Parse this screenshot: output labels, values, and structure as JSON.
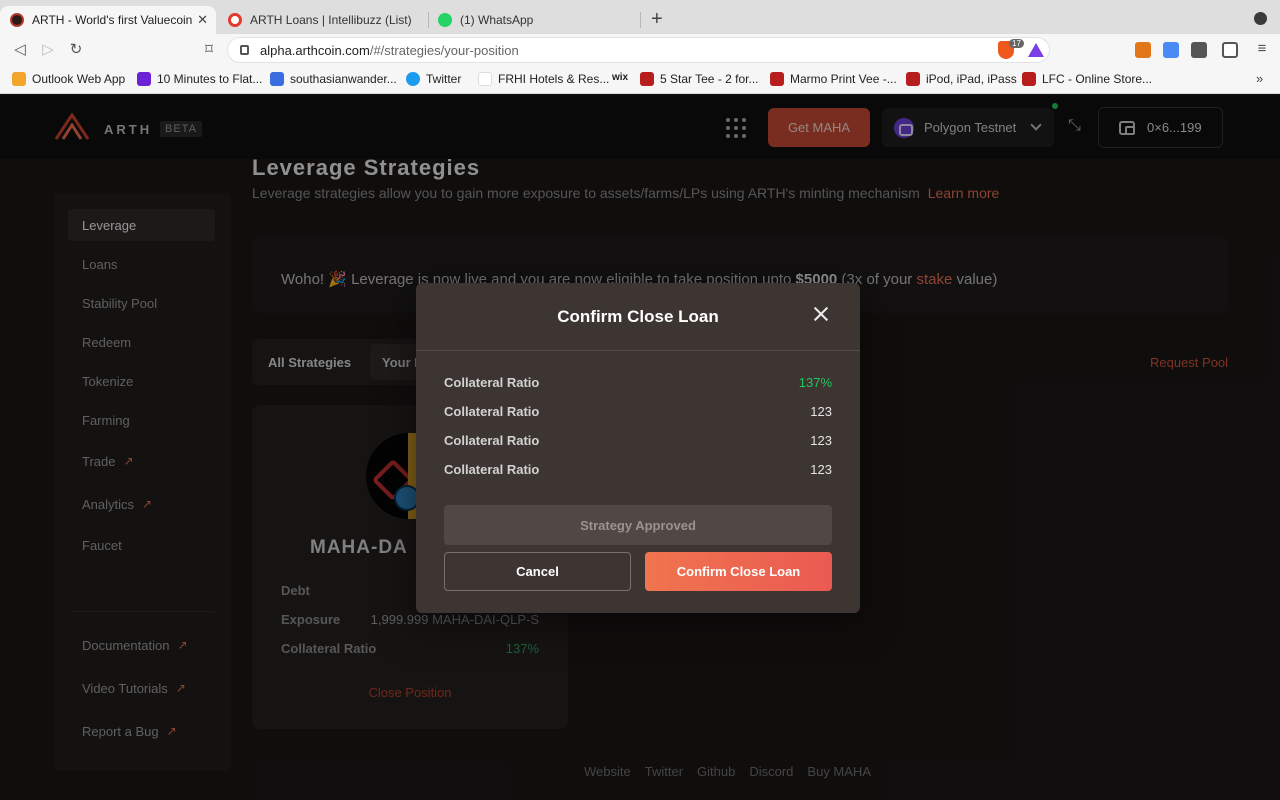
{
  "browser": {
    "tabs": [
      {
        "title": "ARTH - World's first Valuecoin",
        "close": "✕",
        "active": true
      },
      {
        "title": "ARTH Loans | Intellibuzz (List)",
        "active": false
      },
      {
        "title": "(1) WhatsApp",
        "active": false
      }
    ],
    "new_tab": "+",
    "url_host": "alpha.arthcoin.com",
    "url_path": "/#/strategies/your-position",
    "brave_badge": "17",
    "bookmarks": [
      "Outlook Web App",
      "10 Minutes to Flat...",
      "southasianwander...",
      "Twitter",
      "FRHI Hotels & Res...",
      "5 Star Tee - 2 for...",
      "Marmo Print Vee -...",
      "iPod, iPad, iPass",
      "LFC - Online Store..."
    ],
    "bookmarks_more": "»"
  },
  "header": {
    "logo": "ARTH",
    "beta": "BETA",
    "get_maha": "Get MAHA",
    "network": "Polygon Testnet",
    "wallet": "0×6...199"
  },
  "page": {
    "title": "Leverage Strategies",
    "subtitle": "Leverage strategies allow you to gain more exposure to assets/farms/LPs using ARTH's minting mechanism",
    "learn_more": "Learn more"
  },
  "sidebar": {
    "items": [
      {
        "label": "Leverage",
        "external": false
      },
      {
        "label": "Loans",
        "external": false
      },
      {
        "label": "Stability Pool",
        "external": false
      },
      {
        "label": "Redeem",
        "external": false
      },
      {
        "label": "Tokenize",
        "external": false
      },
      {
        "label": "Farming",
        "external": false
      },
      {
        "label": "Trade",
        "external": true
      },
      {
        "label": "Analytics",
        "external": true
      },
      {
        "label": "Faucet",
        "external": false
      }
    ],
    "bottom_items": [
      {
        "label": "Documentation"
      },
      {
        "label": "Video Tutorials"
      },
      {
        "label": "Report a Bug"
      }
    ],
    "arrow": "↗"
  },
  "banner": {
    "pre": "Woho! 🎉 Leverage is now live and you are now eligible to take position upto ",
    "amount": "$5000",
    "mid": " (3x of your ",
    "stake": "stake",
    "post": " value)"
  },
  "tabs": {
    "all": "All Strategies",
    "yours": "Your P"
  },
  "request_pool": "Request Pool",
  "card": {
    "title": "MAHA-DA",
    "rows": [
      {
        "label": "Debt",
        "value": ""
      },
      {
        "label": "Exposure",
        "value": "1,999.999 MAHA-DAI-QLP-S"
      },
      {
        "label": "Collateral Ratio",
        "value": "137%"
      }
    ],
    "close_position": "Close Position"
  },
  "footer": [
    "Website",
    "Twitter",
    "Github",
    "Discord",
    "Buy MAHA"
  ],
  "modal": {
    "title": "Confirm Close Loan",
    "rows": [
      {
        "label": "Collateral Ratio",
        "value": "137%"
      },
      {
        "label": "Collateral Ratio",
        "value": "123"
      },
      {
        "label": "Collateral Ratio",
        "value": "123"
      },
      {
        "label": "Collateral Ratio",
        "value": "123"
      }
    ],
    "approved": "Strategy Approved",
    "cancel": "Cancel",
    "confirm": "Confirm Close Loan"
  },
  "colors": {
    "accent": "#e46e52",
    "positive": "#22c55e",
    "modal_bg": "#3c3532"
  }
}
